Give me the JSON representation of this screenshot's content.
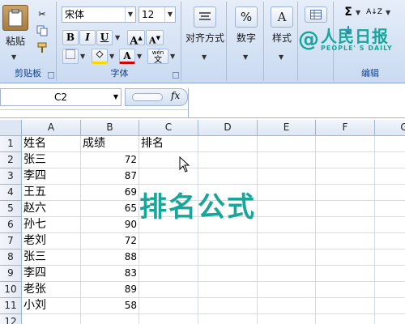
{
  "ribbon": {
    "clipboard": {
      "paste_label": "粘贴",
      "group_label": "剪贴板"
    },
    "font": {
      "font_name": "宋体",
      "font_size": "12",
      "bold": "B",
      "italic": "I",
      "underline": "U",
      "grow": "A",
      "shrink": "A",
      "font_color_glyph": "A",
      "phonetic_label": "wén",
      "phonetic_glyph": "文",
      "group_label": "字体"
    },
    "alignment": {
      "label": "对齐方式"
    },
    "number": {
      "label": "数字",
      "glyph": "%"
    },
    "styles": {
      "label": "样式",
      "glyph": "A"
    },
    "editing": {
      "label": "编辑",
      "sum_glyph": "Σ",
      "sort_glyph": "A↓Z"
    }
  },
  "watermark": {
    "at": "@",
    "name": "人民日报",
    "english": "PEOPLE' S DAILY"
  },
  "formula_bar": {
    "name_box": "C2",
    "fx": "fx",
    "content": ""
  },
  "columns": [
    "A",
    "B",
    "C",
    "D",
    "E",
    "F",
    "G"
  ],
  "rows": [
    {
      "num": "1",
      "a": "姓名",
      "b": "成绩",
      "c": "排名"
    },
    {
      "num": "2",
      "a": "张三",
      "b": "72",
      "c": ""
    },
    {
      "num": "3",
      "a": "李四",
      "b": "87",
      "c": ""
    },
    {
      "num": "4",
      "a": "王五",
      "b": "69",
      "c": ""
    },
    {
      "num": "5",
      "a": "赵六",
      "b": "65",
      "c": ""
    },
    {
      "num": "6",
      "a": "孙七",
      "b": "90",
      "c": ""
    },
    {
      "num": "7",
      "a": "老刘",
      "b": "72",
      "c": ""
    },
    {
      "num": "8",
      "a": "张三",
      "b": "88",
      "c": ""
    },
    {
      "num": "9",
      "a": "李四",
      "b": "83",
      "c": ""
    },
    {
      "num": "10",
      "a": "老张",
      "b": "89",
      "c": ""
    },
    {
      "num": "11",
      "a": "小刘",
      "b": "58",
      "c": ""
    },
    {
      "num": "12",
      "a": "",
      "b": "",
      "c": ""
    }
  ],
  "overlay_text": "排名公式",
  "colors": {
    "watermark": "#17a69a",
    "ribbon_label": "#15428b"
  }
}
